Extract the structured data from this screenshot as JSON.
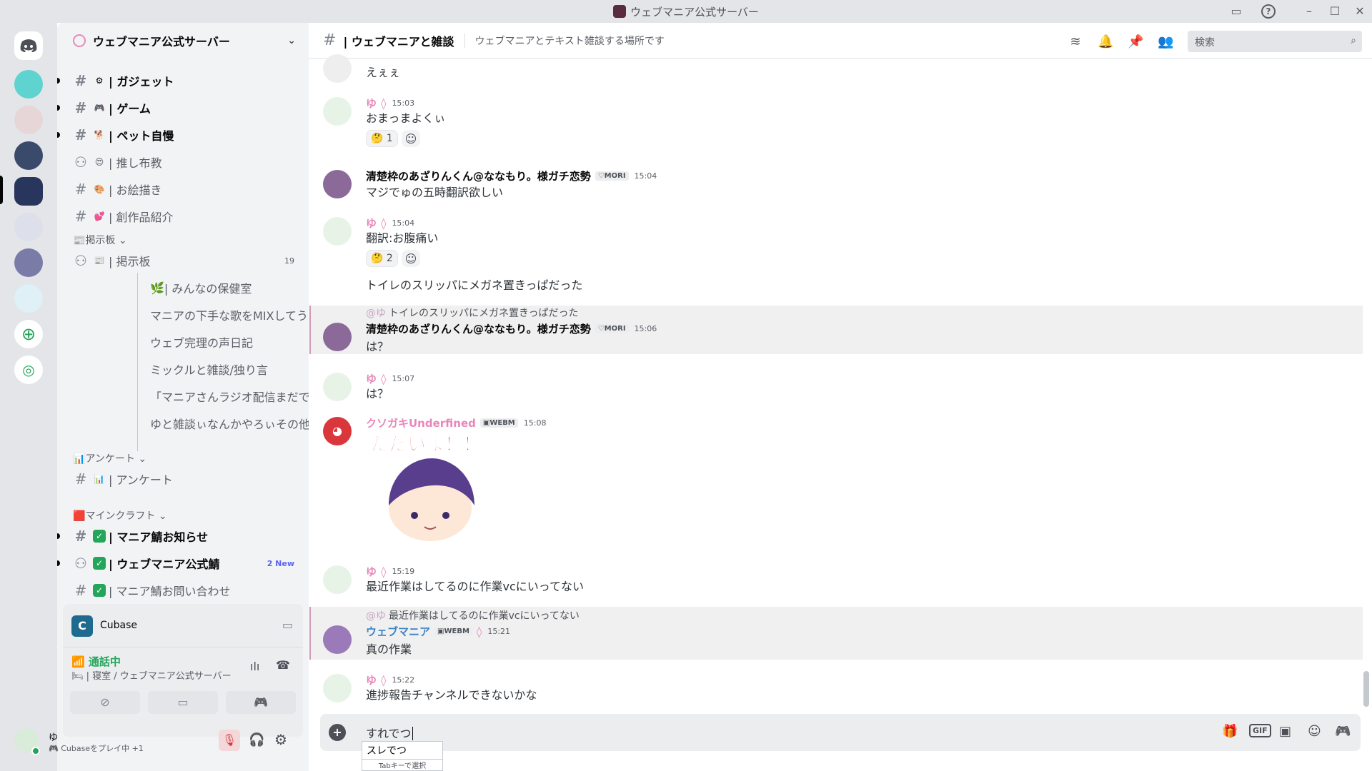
{
  "window": {
    "title": "ウェブマニア公式サーバー"
  },
  "server": {
    "name": "ウェブマニア公式サーバー"
  },
  "channels": [
    {
      "emoji": "⚙",
      "label": "| ガジェット",
      "bold": true
    },
    {
      "emoji": "🎮",
      "label": "| ゲーム",
      "bold": true
    },
    {
      "emoji": "🐕",
      "label": "| ペット自慢",
      "bold": true
    },
    {
      "emoji": "😍",
      "label": "| 推し布教",
      "bold": false
    },
    {
      "emoji": "🎨",
      "label": "| お絵描き",
      "bold": false
    },
    {
      "emoji": "💕",
      "label": "| 創作品紹介",
      "bold": false
    }
  ],
  "category_board": "掲示板",
  "board": {
    "emoji": "📰",
    "label": "| 掲示板",
    "count": "19"
  },
  "threads": [
    "| みんなの保健室",
    "マニアの下手な歌をMIXしてうまくす...",
    "ウェブ完理の声日記",
    "ミックルと雑談/独り言",
    "「マニアさんラジオ配信まだですか...",
    "ゆと雑談ぃなんかやろぃその他"
  ],
  "category_survey": "アンケート",
  "survey_channel": {
    "emoji": "📊",
    "label": "| アンケート"
  },
  "category_minecraft": "マインクラフト",
  "mc_channels": [
    {
      "label": "| マニア鯖お知らせ",
      "bold": true,
      "badge": ""
    },
    {
      "label": "| ウェブマニア公式鯖",
      "bold": true,
      "badge": "2 New"
    },
    {
      "label": "| マニア鯖お問い合わせ",
      "bold": false,
      "badge": ""
    }
  ],
  "activity": {
    "app": "Cubase"
  },
  "voice": {
    "status": "通話中",
    "location": "| 寝室 / ウェブマニア公式サーバー"
  },
  "user": {
    "name": "ゆ",
    "status": "Cubaseをプレイ中 +1"
  },
  "channel_header": {
    "name": "| ウェブマニアと雑談",
    "topic": "ウェブマニアとテキスト雑談する場所です",
    "search_placeholder": "検索"
  },
  "messages": [
    {
      "text": "えぇぇ"
    },
    {
      "user": "ゆ",
      "time": "15:03",
      "text": "おまっまよくぃ",
      "reaction": "1"
    },
    {
      "user": "清楚枠のあざりんくん@ななもり。様ガチ恋勢",
      "tag": "MORI",
      "time": "15:04",
      "text": "マジでゅの五時翻訳欲しい"
    },
    {
      "user": "ゆ",
      "time": "15:04",
      "text": "翻訳:お腹痛い",
      "reaction": "2",
      "text2": "トイレのスリッパにメガネ置きっぱだった"
    },
    {
      "reply_to": "@ゆ",
      "reply_text": "トイレのスリッパにメガネ置きっぱだった",
      "user": "清楚枠のあざりんくん@ななもり。様ガチ恋勢",
      "tag": "MORI",
      "time": "15:06",
      "text": "は？"
    },
    {
      "user": "ゆ",
      "time": "15:07",
      "text": "は？"
    },
    {
      "user": "クソガキUnderfined",
      "tag": "WEBM",
      "time": "15:08",
      "sticker_text": "ただいま！！"
    },
    {
      "user": "ゆ",
      "time": "15:19",
      "text": "最近作業はしてるのに作業vcにいってない"
    },
    {
      "reply_to": "@ゆ",
      "reply_text": "最近作業はしてるのに作業vcにいってない",
      "user": "ウェブマニア",
      "tag": "WEBM",
      "time": "15:21",
      "text": "真の作業"
    },
    {
      "user": "ゆ",
      "time": "15:22",
      "text": "進捗報告チャンネルできないかな"
    }
  ],
  "composer": {
    "value": "すれでつ"
  },
  "autocomplete": {
    "option": "スレでつ",
    "hint": "Tabキーで選択"
  },
  "colors": {
    "accent": "#5865f2",
    "green": "#23a55a",
    "pink": "#e887ba"
  }
}
